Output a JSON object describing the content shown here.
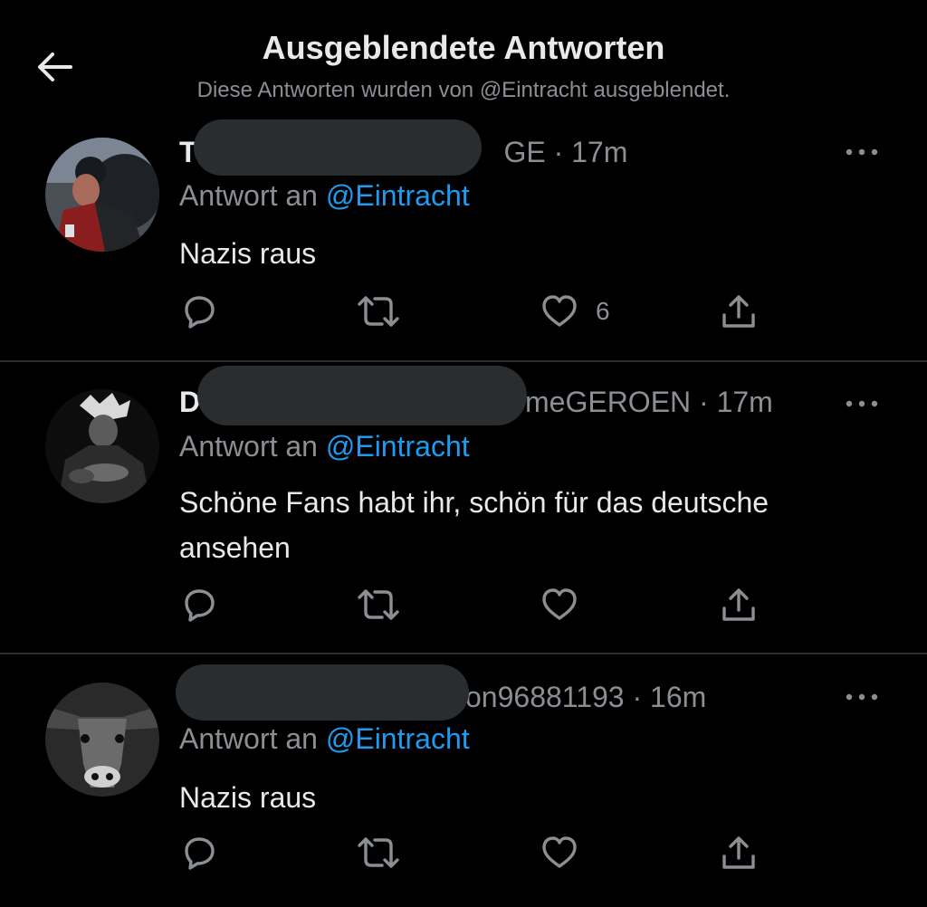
{
  "header": {
    "title": "Ausgeblendete Antworten",
    "subtitle": "Diese Antworten wurden von @Eintracht ausgeblendet."
  },
  "replies": [
    {
      "name_visible_prefix": "T",
      "handle_visible_suffix": "GE",
      "time": "17m",
      "reply_to_label": "Antwort an",
      "reply_to_handle": "@Eintracht",
      "text": "Nazis raus",
      "like_count": "6"
    },
    {
      "name_visible_prefix": "D",
      "handle_visible_suffix": "meGEROEN",
      "time": "17m",
      "reply_to_label": "Antwort an",
      "reply_to_handle": "@Eintracht",
      "text": "Schöne Fans habt ihr, schön für das deutsche ansehen",
      "like_count": ""
    },
    {
      "name_visible_prefix": "",
      "handle_visible_suffix": "on96881193",
      "time": "16m",
      "reply_to_label": "Antwort an",
      "reply_to_handle": "@Eintracht",
      "text": "Nazis raus",
      "like_count": ""
    }
  ],
  "colors": {
    "background": "#000000",
    "text_primary": "#e7e9ea",
    "text_secondary": "#8b8f94",
    "accent": "#1d9bf0",
    "redaction": "#2a2d30",
    "divider": "#2b2f33"
  },
  "icons": [
    "back-arrow-icon",
    "more-icon",
    "reply-icon",
    "retweet-icon",
    "like-icon",
    "share-icon"
  ]
}
